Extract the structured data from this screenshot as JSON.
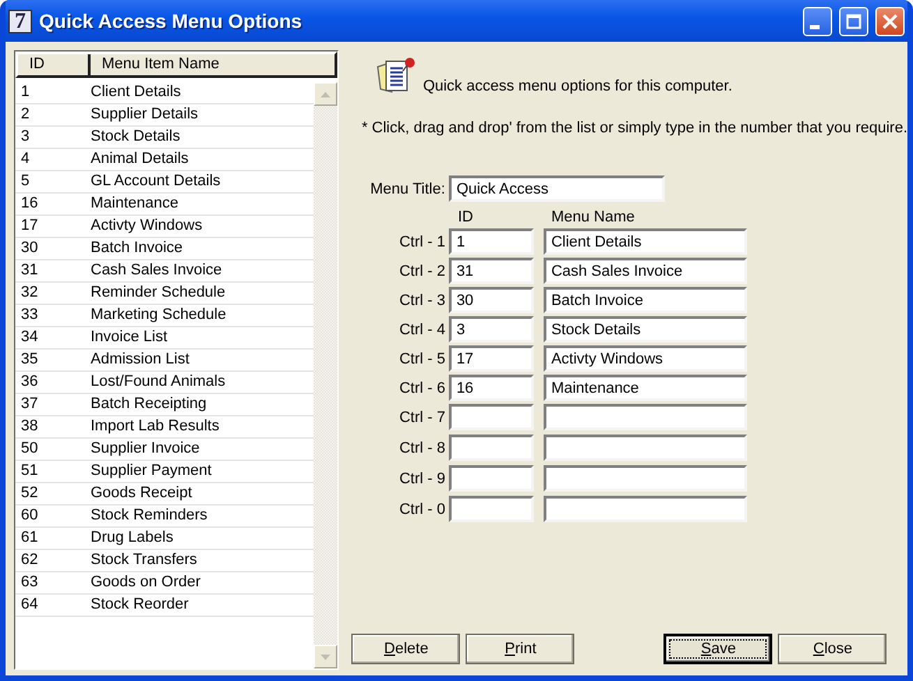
{
  "window": {
    "title": "Quick Access Menu Options",
    "app_icon_text": "7"
  },
  "list": {
    "columns": [
      "ID",
      "Menu Item Name"
    ],
    "rows": [
      {
        "id": "1",
        "name": "Client Details"
      },
      {
        "id": "2",
        "name": "Supplier Details"
      },
      {
        "id": "3",
        "name": "Stock Details"
      },
      {
        "id": "4",
        "name": "Animal Details"
      },
      {
        "id": "5",
        "name": "GL Account Details"
      },
      {
        "id": "16",
        "name": "Maintenance"
      },
      {
        "id": "17",
        "name": "Activty Windows"
      },
      {
        "id": "30",
        "name": "Batch Invoice"
      },
      {
        "id": "31",
        "name": "Cash Sales Invoice"
      },
      {
        "id": "32",
        "name": "Reminder Schedule"
      },
      {
        "id": "33",
        "name": "Marketing Schedule"
      },
      {
        "id": "34",
        "name": "Invoice List"
      },
      {
        "id": "35",
        "name": "Admission List"
      },
      {
        "id": "36",
        "name": "Lost/Found Animals"
      },
      {
        "id": "37",
        "name": "Batch Receipting"
      },
      {
        "id": "38",
        "name": "Import Lab Results"
      },
      {
        "id": "50",
        "name": "Supplier Invoice"
      },
      {
        "id": "51",
        "name": "Supplier Payment"
      },
      {
        "id": "52",
        "name": "Goods Receipt"
      },
      {
        "id": "60",
        "name": "Stock Reminders"
      },
      {
        "id": "61",
        "name": "Drug Labels"
      },
      {
        "id": "62",
        "name": "Stock Transfers"
      },
      {
        "id": "63",
        "name": "Goods on Order"
      },
      {
        "id": "64",
        "name": "Stock Reorder"
      }
    ]
  },
  "intro": "Quick access menu options for this computer.",
  "instruction": "* Click, drag and drop' from the list or simply type in the number that you require.",
  "menu_title": {
    "label": "Menu Title:",
    "value": "Quick Access"
  },
  "shortcut_columns": [
    "ID",
    "Menu Name"
  ],
  "shortcuts": [
    {
      "key": "Ctrl - 1",
      "id": "1",
      "name": "Client Details"
    },
    {
      "key": "Ctrl - 2",
      "id": "31",
      "name": "Cash Sales Invoice"
    },
    {
      "key": "Ctrl - 3",
      "id": "30",
      "name": "Batch Invoice"
    },
    {
      "key": "Ctrl - 4",
      "id": "3",
      "name": "Stock Details"
    },
    {
      "key": "Ctrl - 5",
      "id": "17",
      "name": "Activty Windows"
    },
    {
      "key": "Ctrl - 6",
      "id": "16",
      "name": "Maintenance"
    },
    {
      "key": "Ctrl - 7"
    },
    {
      "key": "Ctrl - 8"
    },
    {
      "key": "Ctrl - 9"
    },
    {
      "key": "Ctrl - 0"
    }
  ],
  "buttons": [
    {
      "label": "Delete",
      "focused": false
    },
    {
      "label": "Print",
      "focused": false
    },
    {
      "label": "Save",
      "focused": true
    },
    {
      "label": "Close",
      "focused": false
    }
  ]
}
